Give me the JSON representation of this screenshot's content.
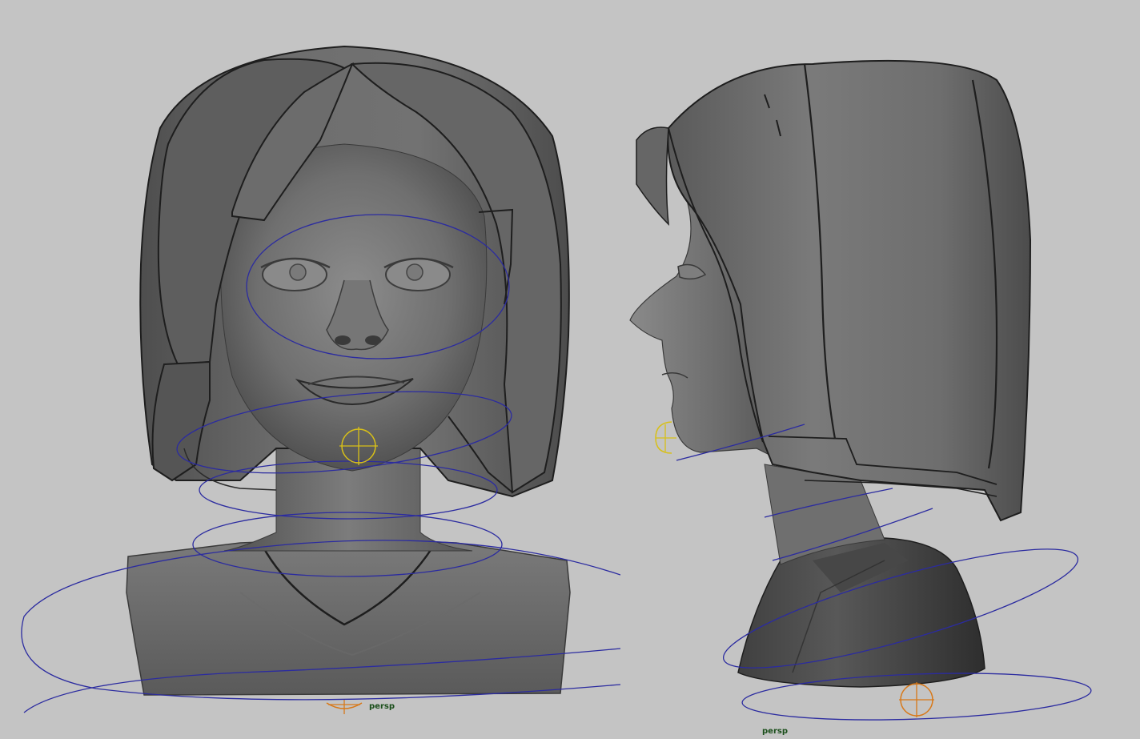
{
  "viewports": {
    "front": {
      "camera_label": "persp"
    },
    "side": {
      "camera_label": "persp"
    }
  },
  "colors": {
    "background": "#c4c4c4",
    "model_shade": "#6e6e6e",
    "model_dark": "#3c3c3c",
    "model_light": "#8a8a8a",
    "rig_curve": "#2b2ba0",
    "locator": "#d8c018",
    "camera_text": "#1b4f1b"
  },
  "icons": [
    "head-control-curve",
    "chin-locator",
    "neck-control-curve",
    "shoulder-control-curve",
    "root-control-curve",
    "root-locator"
  ]
}
